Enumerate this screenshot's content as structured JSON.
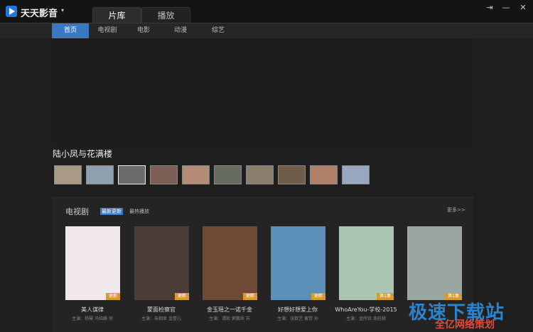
{
  "app": {
    "title": "天天影音",
    "caret": "▾"
  },
  "main_tabs": [
    "片库",
    "播放"
  ],
  "window_controls": {
    "pin": "⇥",
    "minimize": "—",
    "close": "✕"
  },
  "sub_tabs": [
    "首页",
    "电视剧",
    "电影",
    "动漫",
    "综艺"
  ],
  "featured": {
    "title": "陆小凤与花满楼",
    "thumb_colors": [
      "#a99a86",
      "#8fa1b0",
      "#6a6a6a",
      "#7d5f58",
      "#b48c78",
      "#676c62",
      "#8a7f6c",
      "#6f5d49",
      "#b07f6a",
      "#9aa7c0"
    ]
  },
  "tv": {
    "section_label": "电视剧",
    "badge_new": "最新更新",
    "hot": "最热播放",
    "more": "更多>>",
    "items": [
      {
        "title": "美人谋律",
        "cast": "主演：杨幂 冯绍峰 何",
        "ep": "更新",
        "color": "#f1e8ee"
      },
      {
        "title": "蒙面检察官",
        "cast": "主演：朱相显 金誉儿",
        "ep": "更新",
        "color": "#4b3c36"
      },
      {
        "title": "金玉瑶之一诺千金",
        "cast": "主演：谭凯 郭鹏岳 苏",
        "ep": "更新",
        "color": "#6e4a34"
      },
      {
        "title": "好想好想爱上你",
        "cast": "主演：张歆艺 黄觉 孙",
        "ep": "更新",
        "color": "#5b8fb8"
      },
      {
        "title": "WhoAreYou-学校-2015",
        "cast": "主演：金所炫 南柱赫",
        "ep": "第1集",
        "color": "#a9c6b2"
      },
      {
        "title": "",
        "cast": "",
        "ep": "第1集",
        "color": "#9aa6a0"
      }
    ]
  },
  "watermark": {
    "main": "极速下载站",
    "sub": "全亿网络策划"
  }
}
